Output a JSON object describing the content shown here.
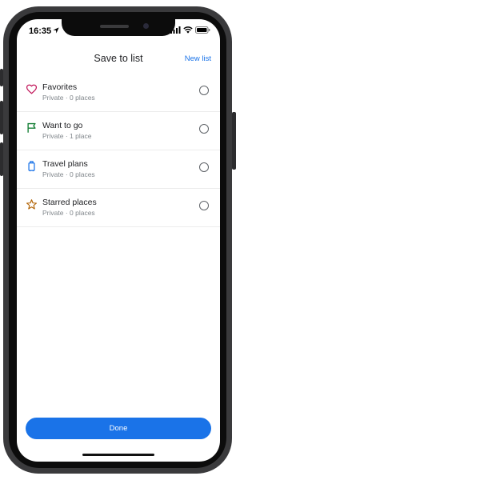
{
  "status": {
    "time": "16:35",
    "icons": [
      "location-arrow-icon",
      "cellular-signal-icon",
      "wifi-icon",
      "battery-icon"
    ]
  },
  "header": {
    "title": "Save to list",
    "new_list_label": "New list"
  },
  "lists": [
    {
      "name": "Favorites",
      "meta": "Private · 0 places",
      "icon": "heart-icon",
      "color": "#c2185b",
      "selected": false
    },
    {
      "name": "Want to go",
      "meta": "Private · 1 place",
      "icon": "flag-icon",
      "color": "#188038",
      "selected": false
    },
    {
      "name": "Travel plans",
      "meta": "Private · 0 places",
      "icon": "suitcase-icon",
      "color": "#1a73e8",
      "selected": false
    },
    {
      "name": "Starred places",
      "meta": "Private · 0 places",
      "icon": "star-icon",
      "color": "#b06000",
      "selected": false
    }
  ],
  "footer": {
    "done_label": "Done"
  },
  "colors": {
    "accent": "#1a73e8",
    "phone_frame": "#3a3a3c"
  }
}
